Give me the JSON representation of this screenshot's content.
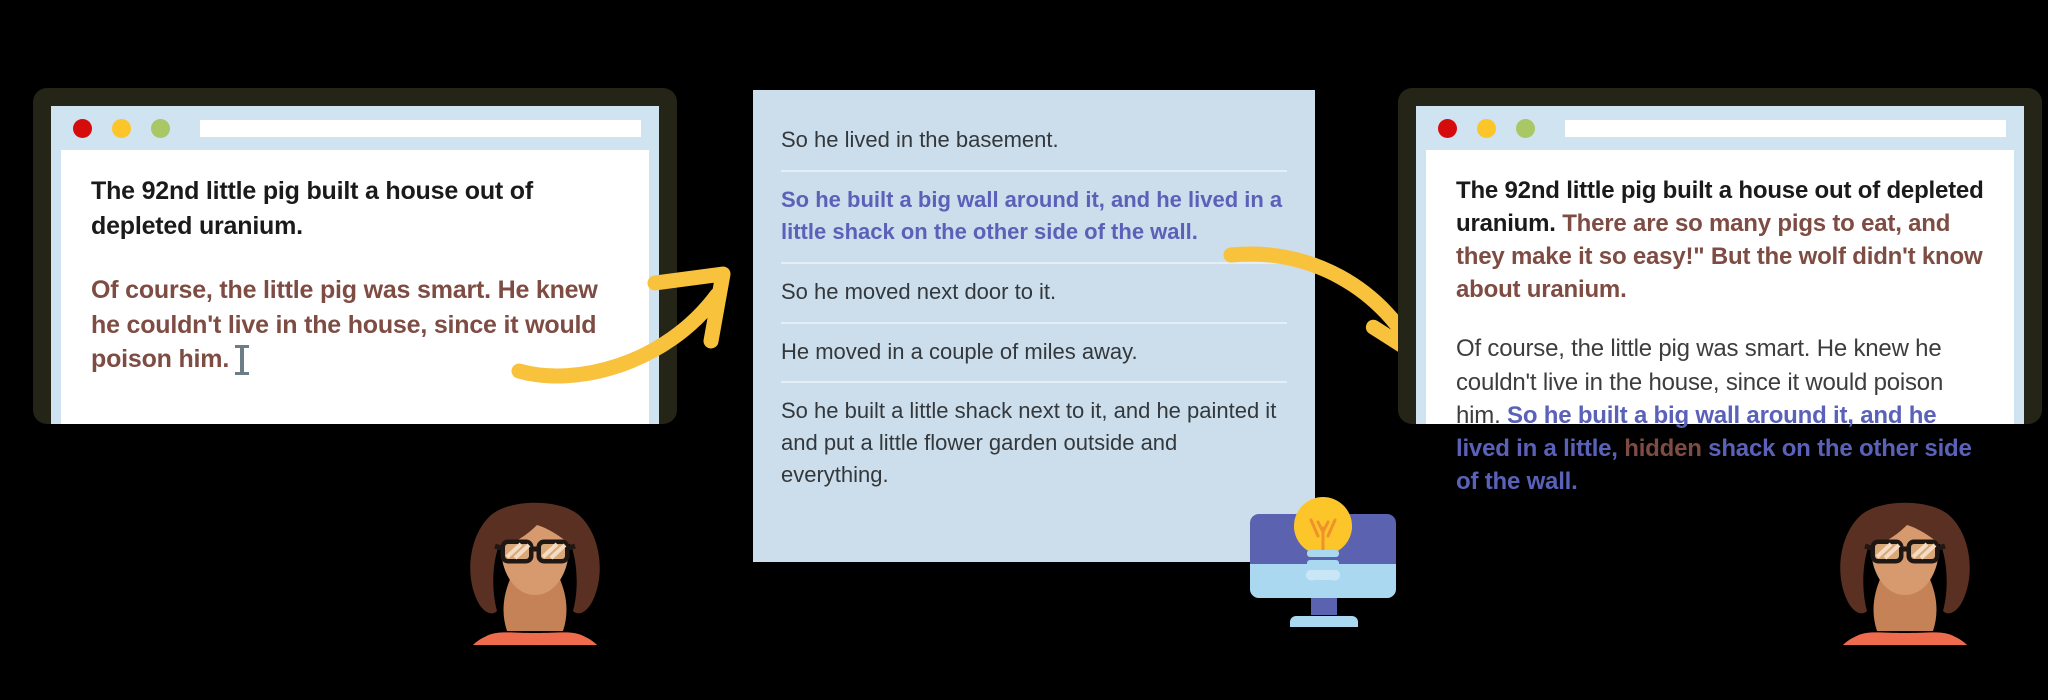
{
  "colors": {
    "window_frame": "#242517",
    "titlebar": "#cfe3f0",
    "page": "#ffffff",
    "panel_bg": "#ccdeeb",
    "accent_yellow": "#f9c23c",
    "text_black": "#1a1a1a",
    "text_brown": "#7e4c43",
    "text_blue": "#5a61b8",
    "text_gray": "#3d3d3d",
    "dot_red": "#d60c0c",
    "dot_yellow": "#fcc52a",
    "dot_green": "#a9c765",
    "monitor_purple": "#5b62b0",
    "monitor_blue": "#a9d8f0",
    "shirt_orange": "#ef6b4d",
    "hair_brown": "#5a3022",
    "skin": "#d79a6e"
  },
  "left_window": {
    "title_dots": [
      "close-dot",
      "minimize-dot",
      "maximize-dot"
    ],
    "url_value": "",
    "paragraphs": [
      {
        "id": "headline",
        "color": "black",
        "text": "The 92nd little pig built a house out of depleted uranium."
      },
      {
        "id": "body",
        "color": "brown",
        "text": "Of course, the little pig was smart. He knew he couldn't live in the house, since it would poison him.",
        "has_cursor": true
      }
    ]
  },
  "middle_panel": {
    "suggestions": [
      {
        "text": "So he lived in the basement.",
        "selected": false
      },
      {
        "text": "So he built a big wall around it, and he lived in a little shack on the other side of the wall.",
        "selected": true
      },
      {
        "text": "So he moved next door to it.",
        "selected": false
      },
      {
        "text": "He moved in a couple of miles away.",
        "selected": false
      },
      {
        "text": "So he built a little shack next to it, and he painted it and put a little flower garden outside and everything.",
        "selected": false
      }
    ]
  },
  "right_window": {
    "title_dots": [
      "close-dot",
      "minimize-dot",
      "maximize-dot"
    ],
    "url_value": "",
    "paragraph_1": {
      "black_part": "The 92nd little pig built a house out of depleted uranium. ",
      "brown_part": "There are so many pigs to eat, and they make it so easy!\" But the wolf didn't know about uranium."
    },
    "paragraph_2": {
      "gray_part": "Of course, the little pig was smart. He knew he couldn't live in the house, since it would poison him. ",
      "blue_part_1": "So he built a big wall around it, and he lived in a little, ",
      "brown_part": "hidden",
      "blue_part_2": " shack on the other side of the wall."
    }
  },
  "icons": {
    "arrow_1": "curved-arrow-up-right",
    "arrow_2": "curved-arrow-down-right",
    "monitor": "monitor-with-lightbulb-icon",
    "avatar_left": "avatar-woman-glasses",
    "avatar_right": "avatar-woman-glasses",
    "text_cursor": "i-beam-text-cursor"
  }
}
